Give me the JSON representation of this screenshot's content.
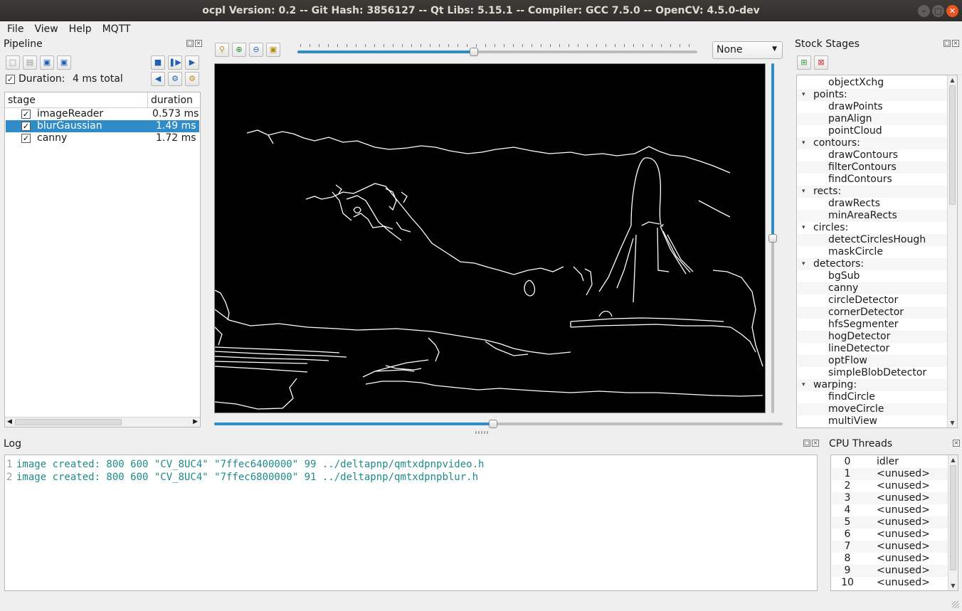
{
  "window": {
    "title": "ocpl Version: 0.2 -- Git Hash: 3856127 -- Qt Libs: 5.15.1 -- Compiler: GCC 7.5.0 -- OpenCV: 4.5.0-dev"
  },
  "menubar": {
    "items": [
      "File",
      "View",
      "Help",
      "MQTT"
    ]
  },
  "pipeline": {
    "title": "Pipeline",
    "duration_label": "Duration:",
    "duration_value": "4 ms total",
    "duration_checked": true,
    "columns": [
      "stage",
      "duration"
    ],
    "rows": [
      {
        "stage": "imageReader",
        "duration": "0.573 ms",
        "checked": true,
        "selected": false
      },
      {
        "stage": "blurGaussian",
        "duration": "1.49 ms",
        "checked": true,
        "selected": true
      },
      {
        "stage": "canny",
        "duration": "1.72 ms",
        "checked": true,
        "selected": false
      }
    ]
  },
  "viewer": {
    "display_select": "None",
    "zoom_slider_value": 0.44,
    "horizontal_scroll_value": 0.49,
    "vertical_scroll_value": 0.5
  },
  "stock_stages": {
    "title": "Stock Stages",
    "items": [
      {
        "label": "objectXchg",
        "type": "leaf"
      },
      {
        "label": "points:",
        "type": "group"
      },
      {
        "label": "drawPoints",
        "type": "leaf"
      },
      {
        "label": "panAlign",
        "type": "leaf"
      },
      {
        "label": "pointCloud",
        "type": "leaf"
      },
      {
        "label": "contours:",
        "type": "group"
      },
      {
        "label": "drawContours",
        "type": "leaf"
      },
      {
        "label": "filterContours",
        "type": "leaf"
      },
      {
        "label": "findContours",
        "type": "leaf"
      },
      {
        "label": "rects:",
        "type": "group"
      },
      {
        "label": "drawRects",
        "type": "leaf"
      },
      {
        "label": "minAreaRects",
        "type": "leaf"
      },
      {
        "label": "circles:",
        "type": "group"
      },
      {
        "label": "detectCirclesHough",
        "type": "leaf"
      },
      {
        "label": "maskCircle",
        "type": "leaf"
      },
      {
        "label": "detectors:",
        "type": "group"
      },
      {
        "label": "bgSub",
        "type": "leaf"
      },
      {
        "label": "canny",
        "type": "leaf"
      },
      {
        "label": "circleDetector",
        "type": "leaf"
      },
      {
        "label": "cornerDetector",
        "type": "leaf"
      },
      {
        "label": "hfsSegmenter",
        "type": "leaf"
      },
      {
        "label": "hogDetector",
        "type": "leaf"
      },
      {
        "label": "lineDetector",
        "type": "leaf"
      },
      {
        "label": "optFlow",
        "type": "leaf"
      },
      {
        "label": "simpleBlobDetector",
        "type": "leaf"
      },
      {
        "label": "warping:",
        "type": "group"
      },
      {
        "label": "findCircle",
        "type": "leaf"
      },
      {
        "label": "moveCircle",
        "type": "leaf"
      },
      {
        "label": "multiView",
        "type": "leaf"
      }
    ]
  },
  "log": {
    "title": "Log",
    "lines": [
      {
        "num": "1",
        "text": "image created: 800 600 \"CV_8UC4\" \"7ffec6400000\" 99 ../deltapnp/qmtxdpnpvideo.h"
      },
      {
        "num": "2",
        "text": "image created: 800 600 \"CV_8UC4\" \"7ffec6800000\" 91 ../deltapnp/qmtxdpnpblur.h"
      }
    ]
  },
  "cpu_threads": {
    "title": "CPU Threads",
    "rows": [
      {
        "id": "0",
        "name": "idler"
      },
      {
        "id": "1",
        "name": "<unused>"
      },
      {
        "id": "2",
        "name": "<unused>"
      },
      {
        "id": "3",
        "name": "<unused>"
      },
      {
        "id": "4",
        "name": "<unused>"
      },
      {
        "id": "5",
        "name": "<unused>"
      },
      {
        "id": "6",
        "name": "<unused>"
      },
      {
        "id": "7",
        "name": "<unused>"
      },
      {
        "id": "8",
        "name": "<unused>"
      },
      {
        "id": "9",
        "name": "<unused>"
      },
      {
        "id": "10",
        "name": "<unused>"
      }
    ]
  },
  "colors": {
    "selection": "#308cc6",
    "titlebar": "#3c3b37",
    "close": "#e95420",
    "log_text": "#1f8a8a"
  }
}
